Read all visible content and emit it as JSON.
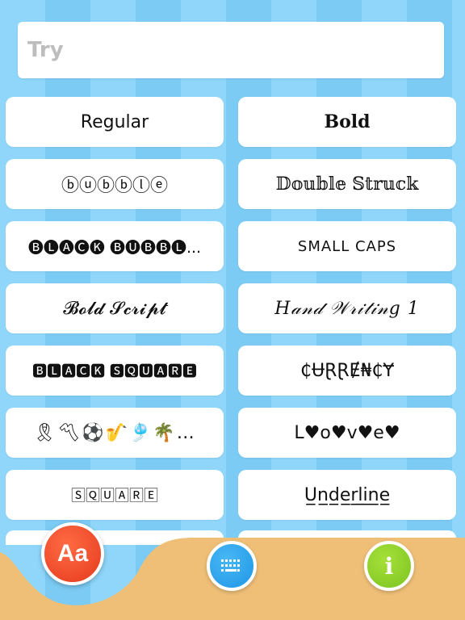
{
  "search": {
    "placeholder": "Try",
    "value": ""
  },
  "styles": {
    "left": [
      {
        "id": "regular",
        "label": "Regular"
      },
      {
        "id": "bubble",
        "label": "ⓑⓤⓑⓑⓛⓔ"
      },
      {
        "id": "black-bubble",
        "label": "🅑🅛🅐🅒🅚 🅑🅤🅑🅑🅛..."
      },
      {
        "id": "bold-script",
        "label": "𝓑𝓸𝓵𝓭 𝓢𝓬𝓻𝓲𝓹𝓽"
      },
      {
        "id": "black-square",
        "label": "🅱🅻🅰🅲🅺 🆂🆀🆄🅰🆁🅴"
      },
      {
        "id": "emoji",
        "label": "🎗〽⚽🎷🎐🌴…"
      },
      {
        "id": "square",
        "label": "🅂🅀🅄🄰🅁🄴"
      }
    ],
    "right": [
      {
        "id": "bold",
        "label": "Bold"
      },
      {
        "id": "double-struck",
        "label": "𝔻𝕠𝕦𝕓𝕝𝕖 𝕊𝕥𝕣𝕦𝕔𝕜"
      },
      {
        "id": "small-caps",
        "label": "SMALL CAPS"
      },
      {
        "id": "handwriting",
        "label": "𝐻𝒶𝓃𝒹 𝒲𝓇𝒾𝓉𝒾𝓃𝑔 1"
      },
      {
        "id": "currency",
        "label": "₵ɄⱤⱤɆ₦₵Ɏ"
      },
      {
        "id": "love",
        "label": "L♥o♥v♥e♥"
      },
      {
        "id": "underline",
        "label": "U̲n̲d̲e̲r̲l̲i̲n̲e̲"
      }
    ]
  },
  "tabbar": {
    "fonts_label": "Aa",
    "keyboard_icon": "keyboard-icon",
    "info_label": "i"
  },
  "colors": {
    "background_stripe_a": "#8fd6fa",
    "background_stripe_b": "#7ccbf4",
    "sand": "#efbf78",
    "fonts_tab": "#e8442a",
    "keyboard_tab": "#2a9ee8",
    "info_tab": "#8bcc2a"
  }
}
